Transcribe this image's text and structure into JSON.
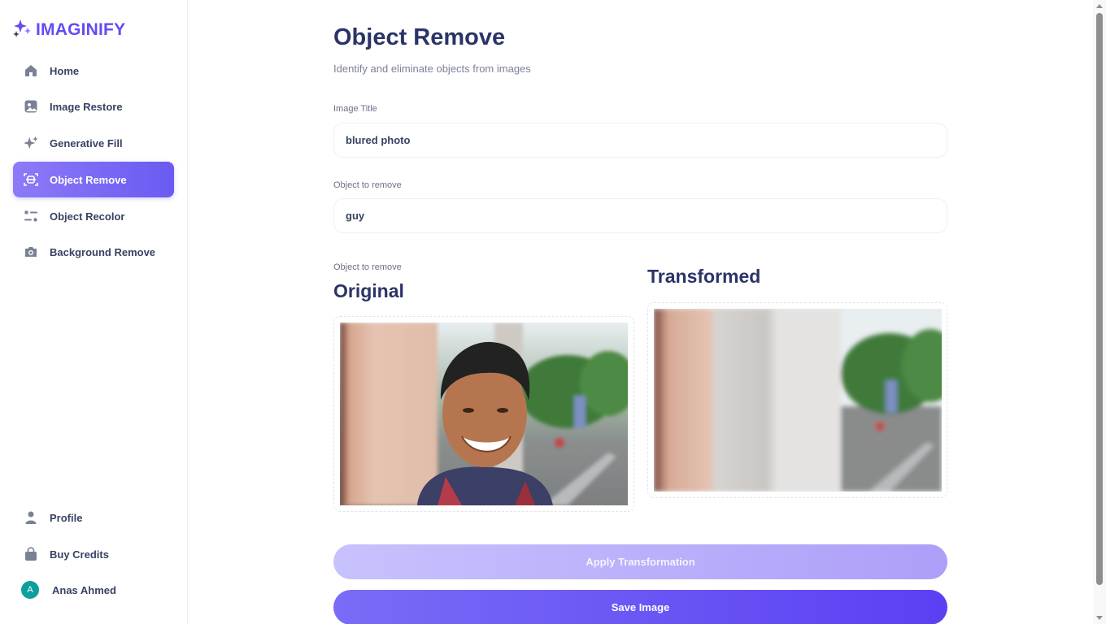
{
  "app": {
    "logo_text": "IMAGINIFY"
  },
  "sidebar": {
    "items": [
      {
        "label": "Home",
        "icon": "home-icon"
      },
      {
        "label": "Image Restore",
        "icon": "image-icon"
      },
      {
        "label": "Generative Fill",
        "icon": "sparkles-icon"
      },
      {
        "label": "Object Remove",
        "icon": "scan-icon",
        "active": true
      },
      {
        "label": "Object Recolor",
        "icon": "filter-icon"
      },
      {
        "label": "Background Remove",
        "icon": "camera-icon"
      }
    ],
    "bottom": [
      {
        "label": "Profile",
        "icon": "user-icon"
      },
      {
        "label": "Buy Credits",
        "icon": "bag-icon"
      }
    ],
    "user": {
      "name": "Anas Ahmed",
      "initial": "A",
      "avatar_color": "#0f9e9e"
    }
  },
  "page": {
    "title": "Object Remove",
    "subtitle": "Identify and eliminate objects from images"
  },
  "form": {
    "title_label": "Image Title",
    "title_value": "blured photo",
    "object_label": "Object to remove",
    "object_value": "guy",
    "media_label": "Object to remove"
  },
  "images": {
    "original_heading": "Original",
    "transformed_heading": "Transformed"
  },
  "buttons": {
    "apply": "Apply Transformation",
    "save": "Save Image"
  },
  "colors": {
    "accent": "#624cf5",
    "title": "#2b3467",
    "text": "#384262"
  }
}
